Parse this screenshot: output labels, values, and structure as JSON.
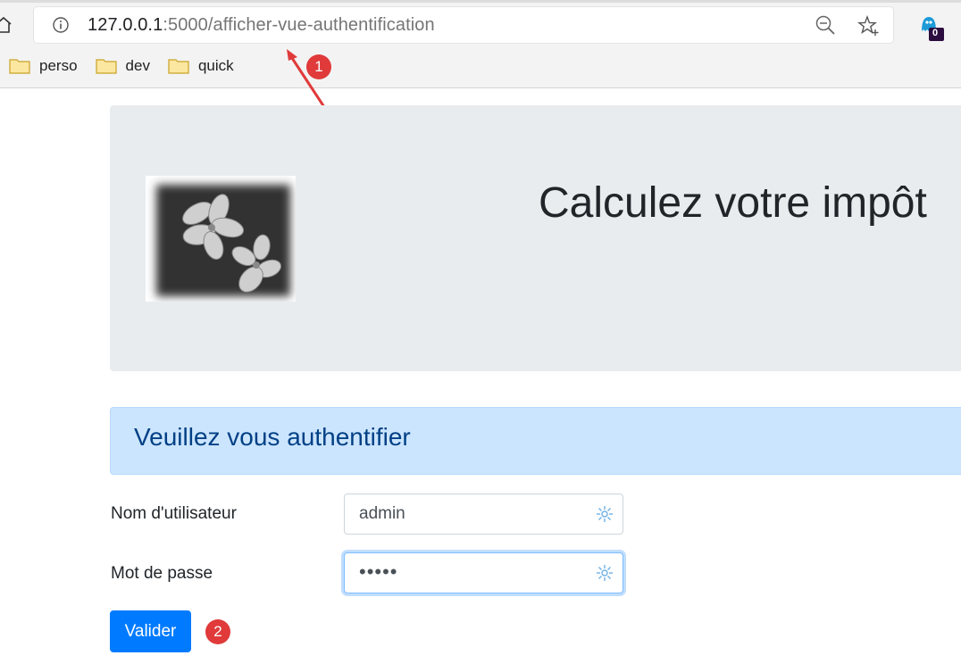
{
  "browser": {
    "url_host": "127.0.0.1",
    "url_rest": ":5000/afficher-vue-authentification",
    "extension_badge": "0",
    "bookmarks": [
      {
        "label": "perso"
      },
      {
        "label": "dev"
      },
      {
        "label": "quick"
      }
    ]
  },
  "annotations": {
    "callout_1": "1",
    "callout_2": "2"
  },
  "page": {
    "title": "Calculez votre impôt",
    "auth_heading": "Veuillez vous authentifier",
    "username_label": "Nom d'utilisateur",
    "username_value": "admin",
    "password_label": "Mot de passe",
    "password_value": "•••••",
    "submit_label": "Valider"
  },
  "colors": {
    "primary": "#007bff",
    "alert_bg": "#cce5ff",
    "alert_text": "#004085",
    "jumbotron_bg": "#e9ecef",
    "callout": "#e03a3a"
  }
}
